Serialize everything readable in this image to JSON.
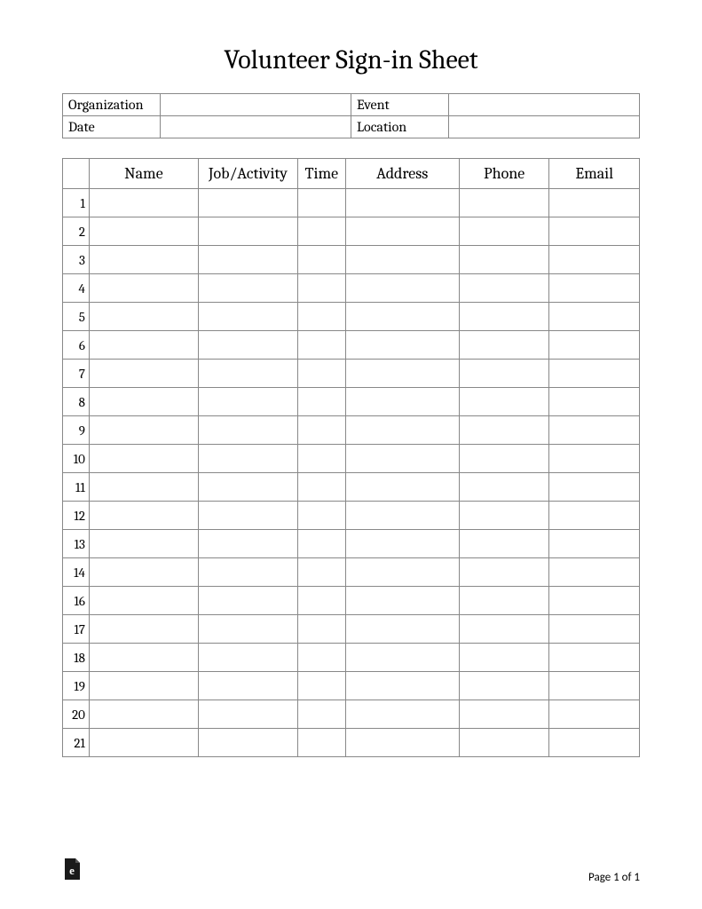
{
  "title": "Volunteer Sign-in Sheet",
  "meta": {
    "organization_label": "Organization",
    "organization_value": "",
    "event_label": "Event",
    "event_value": "",
    "date_label": "Date",
    "date_value": "",
    "location_label": "Location",
    "location_value": ""
  },
  "columns": {
    "num": "",
    "name": "Name",
    "job": "Job/Activity",
    "time": "Time",
    "address": "Address",
    "phone": "Phone",
    "email": "Email"
  },
  "rows": [
    {
      "num": "1",
      "name": "",
      "job": "",
      "time": "",
      "address": "",
      "phone": "",
      "email": ""
    },
    {
      "num": "2",
      "name": "",
      "job": "",
      "time": "",
      "address": "",
      "phone": "",
      "email": ""
    },
    {
      "num": "3",
      "name": "",
      "job": "",
      "time": "",
      "address": "",
      "phone": "",
      "email": ""
    },
    {
      "num": "4",
      "name": "",
      "job": "",
      "time": "",
      "address": "",
      "phone": "",
      "email": ""
    },
    {
      "num": "5",
      "name": "",
      "job": "",
      "time": "",
      "address": "",
      "phone": "",
      "email": ""
    },
    {
      "num": "6",
      "name": "",
      "job": "",
      "time": "",
      "address": "",
      "phone": "",
      "email": ""
    },
    {
      "num": "7",
      "name": "",
      "job": "",
      "time": "",
      "address": "",
      "phone": "",
      "email": ""
    },
    {
      "num": "8",
      "name": "",
      "job": "",
      "time": "",
      "address": "",
      "phone": "",
      "email": ""
    },
    {
      "num": "9",
      "name": "",
      "job": "",
      "time": "",
      "address": "",
      "phone": "",
      "email": ""
    },
    {
      "num": "10",
      "name": "",
      "job": "",
      "time": "",
      "address": "",
      "phone": "",
      "email": ""
    },
    {
      "num": "11",
      "name": "",
      "job": "",
      "time": "",
      "address": "",
      "phone": "",
      "email": ""
    },
    {
      "num": "12",
      "name": "",
      "job": "",
      "time": "",
      "address": "",
      "phone": "",
      "email": ""
    },
    {
      "num": "13",
      "name": "",
      "job": "",
      "time": "",
      "address": "",
      "phone": "",
      "email": ""
    },
    {
      "num": "14",
      "name": "",
      "job": "",
      "time": "",
      "address": "",
      "phone": "",
      "email": ""
    },
    {
      "num": "16",
      "name": "",
      "job": "",
      "time": "",
      "address": "",
      "phone": "",
      "email": ""
    },
    {
      "num": "17",
      "name": "",
      "job": "",
      "time": "",
      "address": "",
      "phone": "",
      "email": ""
    },
    {
      "num": "18",
      "name": "",
      "job": "",
      "time": "",
      "address": "",
      "phone": "",
      "email": ""
    },
    {
      "num": "19",
      "name": "",
      "job": "",
      "time": "",
      "address": "",
      "phone": "",
      "email": ""
    },
    {
      "num": "20",
      "name": "",
      "job": "",
      "time": "",
      "address": "",
      "phone": "",
      "email": ""
    },
    {
      "num": "21",
      "name": "",
      "job": "",
      "time": "",
      "address": "",
      "phone": "",
      "email": ""
    }
  ],
  "footer": {
    "page_label": "Page 1 of 1"
  }
}
